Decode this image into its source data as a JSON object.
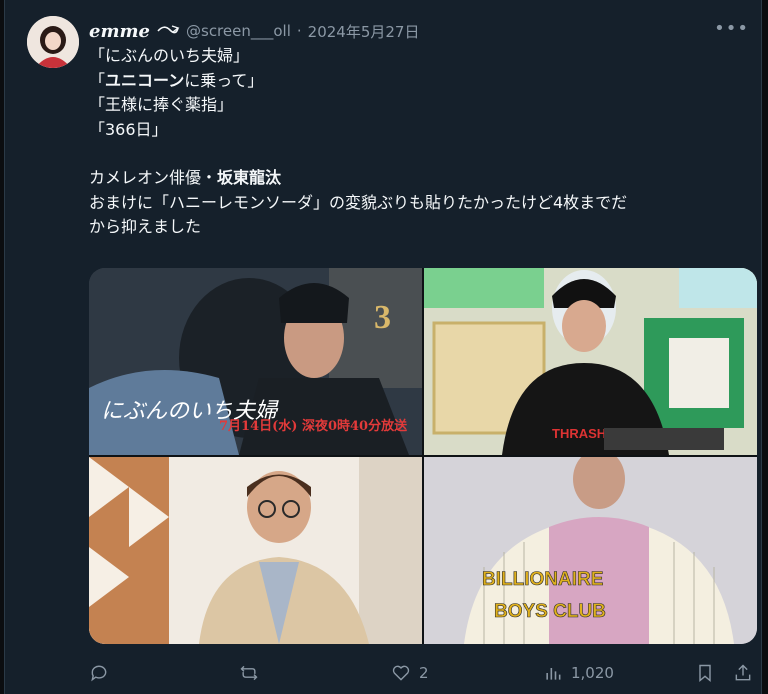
{
  "author": {
    "display_name": "emme",
    "handle": "@screen___oll",
    "separator": "·",
    "date": "2024年5月27日"
  },
  "post": {
    "lines": [
      "「にぶんのいち夫婦」",
      "「ユニコーンに乗って」",
      "「王様に捧ぐ薬指」",
      "「366日」"
    ],
    "line2_bold": "ユニコーン",
    "line2_rest": "に乗って」",
    "line2_open": "「",
    "actor_prefix": "カメレオン俳優・",
    "actor_name": "坂東龍汰",
    "note_line1": "おまけに「ハニーレモンソーダ」の変貌ぶりも貼りたかったけど4枚までだ",
    "note_line2": "から抑えました"
  },
  "media": {
    "image1_title": "にぶんのいち夫婦",
    "image1_schedule": "7月14日(水) 深夜0時40分放送",
    "image2_shirt": "THRASHER",
    "image4_jacket_line1": "BILLIONAIRE",
    "image4_jacket_line2": "BOYS CLUB"
  },
  "actions": {
    "replies": "",
    "reposts": "",
    "likes": "2",
    "views": "1,020"
  },
  "colors": {
    "background": "#15202b",
    "text": "#f5f8fa",
    "muted": "#8b98a5"
  }
}
